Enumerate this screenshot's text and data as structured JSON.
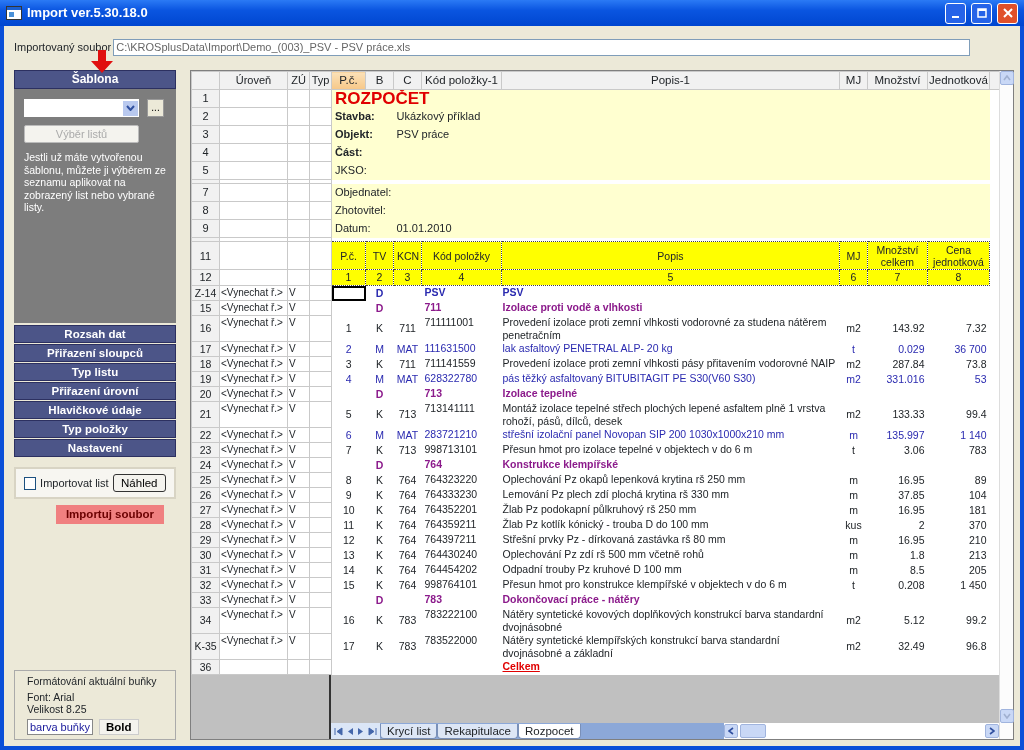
{
  "window": {
    "title": "Import ver.5.30.18.0"
  },
  "file": {
    "label": "Importovaný soubor",
    "value": "C:\\KROSplusData\\Import\\Demo_(003)_PSV - PSV práce.xls"
  },
  "wizard": {
    "header": "Šablona",
    "browse_button": "...",
    "sheet_select": {
      "label": "Výběr listů",
      "disabled": true
    },
    "help": "Jestli už máte vytvořenou šablonu, můžete ji výběrem ze seznamu aplikovat na zobrazený list nebo vybrané listy.",
    "steps": [
      "Rozsah dat",
      "Přiřazení sloupců",
      "Typ listu",
      "Přiřazení úrovní",
      "Hlavičkové údaje",
      "Typ položky",
      "Nastavení"
    ]
  },
  "import_sheet": {
    "label": "Importovat list",
    "checked": false
  },
  "preview_button": "Náhled",
  "import_button": "Importuj soubor",
  "cell_format": {
    "title": "Formátování aktuální buňky",
    "font": "Font: Arial",
    "size": "Velikost 8.25",
    "color_button": "barva buňky",
    "bold_button": "Bold"
  },
  "grid": {
    "left_columns": [
      "Úroveň",
      "ZÚ",
      "Typ"
    ],
    "columns": [
      {
        "label": "P.č.",
        "selected": true
      },
      {
        "label": "B",
        "selected": false
      },
      {
        "label": "C",
        "selected": false
      },
      {
        "label": "Kód položky-1",
        "selected": false
      },
      {
        "label": "Popis-1",
        "selected": false
      },
      {
        "label": "MJ",
        "selected": false
      },
      {
        "label": "Množství",
        "selected": false
      },
      {
        "label": "Jednotková",
        "selected": false
      }
    ],
    "rows": [
      {
        "number": "1",
        "kind": "title",
        "cells": [
          "ROZPOČET"
        ]
      },
      {
        "number": "2",
        "kind": "info",
        "bold": true,
        "cells": [
          "Stavba:",
          "Ukázkový příklad"
        ]
      },
      {
        "number": "3",
        "kind": "info",
        "bold": true,
        "cells": [
          "Objekt:",
          "PSV práce"
        ]
      },
      {
        "number": "4",
        "kind": "info",
        "bold": true,
        "cells": [
          "Část:"
        ]
      },
      {
        "number": "5",
        "kind": "info",
        "bold": false,
        "cells": [
          "JKSO:"
        ]
      },
      {
        "kind": "hidden"
      },
      {
        "number": "7",
        "kind": "info",
        "bold": false,
        "cells": [
          "Objednatel:"
        ]
      },
      {
        "number": "8",
        "kind": "info",
        "bold": false,
        "cells": [
          "Zhotovitel:"
        ]
      },
      {
        "number": "9",
        "kind": "info",
        "bold": false,
        "cells": [
          "Datum:",
          "01.01.2010"
        ]
      },
      {
        "kind": "hidden"
      },
      {
        "number": "11",
        "kind": "header",
        "cells": [
          "P.č.",
          "TV",
          "KCN",
          "Kód položky",
          "Popis",
          "MJ",
          "Množství celkem",
          "Cena jednotková"
        ]
      },
      {
        "number": "12",
        "kind": "index",
        "cells": [
          "1",
          "2",
          "3",
          "4",
          "5",
          "6",
          "7",
          "8"
        ]
      },
      {
        "number": "Z-14",
        "level": "<Vynechat ř.>",
        "zu": "V",
        "kind": "chapter",
        "cursor": true,
        "cells": [
          "",
          "D",
          "",
          "PSV",
          "PSV"
        ]
      },
      {
        "number": "15",
        "level": "<Vynechat ř.>",
        "zu": "V",
        "kind": "section",
        "cells": [
          "",
          "D",
          "",
          "711",
          "Izolace proti vodě a vlhkosti"
        ]
      },
      {
        "number": "16",
        "level": "<Vynechat ř.>",
        "zu": "V",
        "kind": "item",
        "cells": [
          "1",
          "K",
          "711",
          "711111001",
          "Provedení izolace proti zemní vlhkosti vodorovné za studena nátěrem penetračním",
          "m2",
          "143.92",
          "7.32"
        ]
      },
      {
        "number": "17",
        "level": "<Vynechat ř.>",
        "zu": "V",
        "kind": "material",
        "cells": [
          "2",
          "M",
          "MAT",
          "111631500",
          "lak asfaltový PENETRAL ALP- 20 kg",
          "t",
          "0.029",
          "36 700"
        ]
      },
      {
        "number": "18",
        "level": "<Vynechat ř.>",
        "zu": "V",
        "kind": "item",
        "cells": [
          "3",
          "K",
          "711",
          "711141559",
          "Provedení izolace proti zemní vlhkosti pásy přitavením vodorovné NAIP",
          "m2",
          "287.84",
          "73.8"
        ]
      },
      {
        "number": "19",
        "level": "<Vynechat ř.>",
        "zu": "V",
        "kind": "material",
        "cells": [
          "4",
          "M",
          "MAT",
          "628322780",
          "pás těžký asfaltovaný BITUBITAGIT PE S30(V60 S30)",
          "m2",
          "331.016",
          "53"
        ]
      },
      {
        "number": "20",
        "level": "<Vynechat ř.>",
        "zu": "V",
        "kind": "section",
        "cells": [
          "",
          "D",
          "",
          "713",
          "Izolace tepelné"
        ]
      },
      {
        "number": "21",
        "level": "<Vynechat ř.>",
        "zu": "V",
        "kind": "item",
        "cells": [
          "5",
          "K",
          "713",
          "713141111",
          "Montáž izolace tepelné střech plochých lepené asfaltem plně 1 vrstva rohoží, pásů, dílců, desek",
          "m2",
          "133.33",
          "99.4"
        ]
      },
      {
        "number": "22",
        "level": "<Vynechat ř.>",
        "zu": "V",
        "kind": "material",
        "cells": [
          "6",
          "M",
          "MAT",
          "283721210",
          "střešní izolační panel Novopan SIP 200 1030x1000x210 mm",
          "m",
          "135.997",
          "1 140"
        ]
      },
      {
        "number": "23",
        "level": "<Vynechat ř.>",
        "zu": "V",
        "kind": "item",
        "cells": [
          "7",
          "K",
          "713",
          "998713101",
          "Přesun hmot pro izolace tepelné v objektech v do 6 m",
          "t",
          "3.06",
          "783"
        ]
      },
      {
        "number": "24",
        "level": "<Vynechat ř.>",
        "zu": "V",
        "kind": "section",
        "cells": [
          "",
          "D",
          "",
          "764",
          "Konstrukce klempířské"
        ]
      },
      {
        "number": "25",
        "level": "<Vynechat ř.>",
        "zu": "V",
        "kind": "item",
        "cells": [
          "8",
          "K",
          "764",
          "764323220",
          "Oplechování Pz okapů lepenková krytina rš 250 mm",
          "m",
          "16.95",
          "89"
        ]
      },
      {
        "number": "26",
        "level": "<Vynechat ř.>",
        "zu": "V",
        "kind": "item",
        "cells": [
          "9",
          "K",
          "764",
          "764333230",
          "Lemování Pz plech zdí plochá krytina rš 330 mm",
          "m",
          "37.85",
          "104"
        ]
      },
      {
        "number": "27",
        "level": "<Vynechat ř.>",
        "zu": "V",
        "kind": "item",
        "cells": [
          "10",
          "K",
          "764",
          "764352201",
          "Žlab Pz podokapní půlkruhový rš 250 mm",
          "m",
          "16.95",
          "181"
        ]
      },
      {
        "number": "28",
        "level": "<Vynechat ř.>",
        "zu": "V",
        "kind": "item",
        "cells": [
          "11",
          "K",
          "764",
          "764359211",
          "Žlab Pz kotlík kónický - trouba D do 100 mm",
          "kus",
          "2",
          "370"
        ]
      },
      {
        "number": "29",
        "level": "<Vynechat ř.>",
        "zu": "V",
        "kind": "item",
        "cells": [
          "12",
          "K",
          "764",
          "764397211",
          "Střešní prvky Pz - dírkovaná zastávka rš 80 mm",
          "m",
          "16.95",
          "210"
        ]
      },
      {
        "number": "30",
        "level": "<Vynechat ř.>",
        "zu": "V",
        "kind": "item",
        "cells": [
          "13",
          "K",
          "764",
          "764430240",
          "Oplechování Pz zdí rš 500 mm včetně rohů",
          "m",
          "1.8",
          "213"
        ]
      },
      {
        "number": "31",
        "level": "<Vynechat ř.>",
        "zu": "V",
        "kind": "item",
        "cells": [
          "14",
          "K",
          "764",
          "764454202",
          "Odpadní trouby Pz kruhové D 100 mm",
          "m",
          "8.5",
          "205"
        ]
      },
      {
        "number": "32",
        "level": "<Vynechat ř.>",
        "zu": "V",
        "kind": "item",
        "cells": [
          "15",
          "K",
          "764",
          "998764101",
          "Přesun hmot pro konstrukce klempířské v objektech v do 6 m",
          "t",
          "0.208",
          "1 450"
        ]
      },
      {
        "number": "33",
        "level": "<Vynechat ř.>",
        "zu": "V",
        "kind": "section",
        "cells": [
          "",
          "D",
          "",
          "783",
          "Dokončovací práce - nátěry"
        ]
      },
      {
        "number": "34",
        "level": "<Vynechat ř.>",
        "zu": "V",
        "kind": "item",
        "cells": [
          "16",
          "K",
          "783",
          "783222100",
          "Nátěry syntetické kovových doplňkových konstrukcí barva standardní dvojnásobné",
          "m2",
          "5.12",
          "99.2"
        ]
      },
      {
        "number": "K-35",
        "level": "<Vynechat ř.>",
        "zu": "V",
        "kind": "item",
        "cells": [
          "17",
          "K",
          "783",
          "783522000",
          "Nátěry syntetické klempířských konstrukcí barva standardní dvojnásobné a základní",
          "m2",
          "32.49",
          "96.8"
        ]
      },
      {
        "number": "36",
        "kind": "total",
        "cells": [
          "",
          "",
          "",
          "",
          "Celkem"
        ]
      }
    ]
  },
  "sheet_tabs": [
    {
      "label": "Krycí list",
      "selected": false
    },
    {
      "label": "Rekapitulace",
      "selected": false
    },
    {
      "label": "Rozpocet",
      "selected": true
    }
  ]
}
